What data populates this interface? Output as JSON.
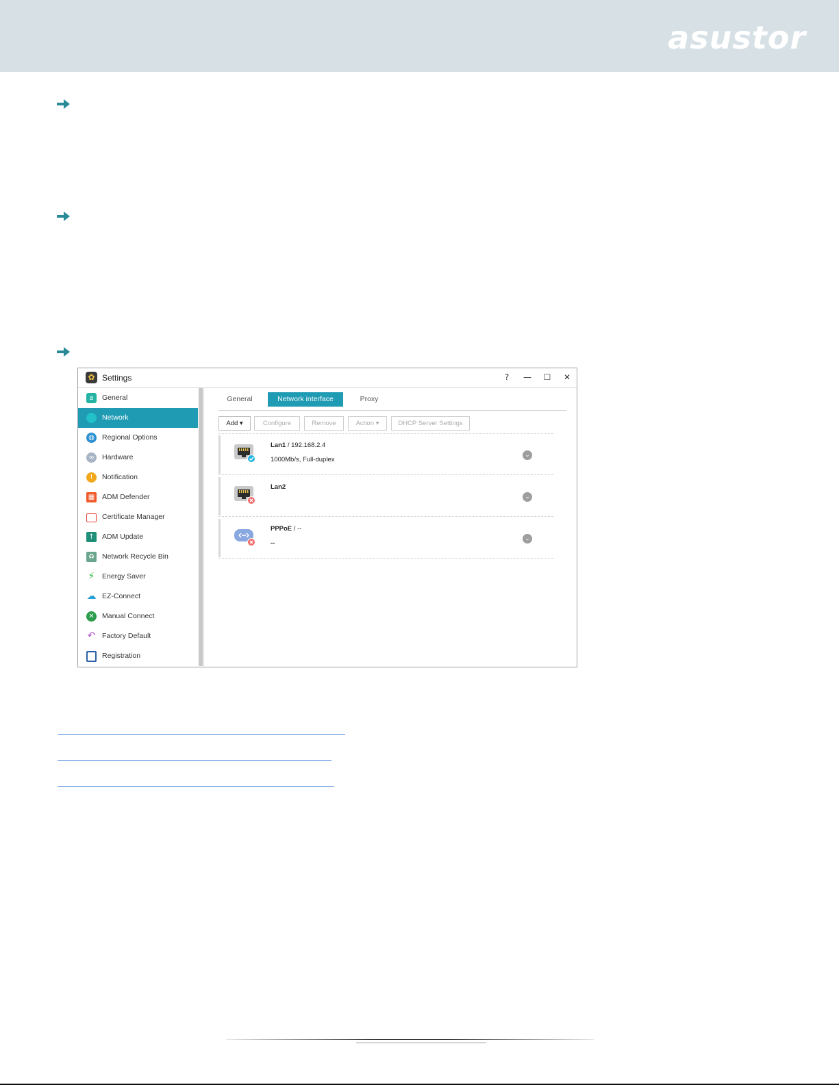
{
  "brand": {
    "logo_text": "asustor"
  },
  "window": {
    "title": "Settings",
    "controls": [
      "?",
      "—",
      "☐",
      "✕"
    ]
  },
  "sidebar": {
    "items": [
      {
        "label": "General",
        "icon": "general-icon",
        "color": "#22b3a3"
      },
      {
        "label": "Network",
        "icon": "globe-icon",
        "color": "#22c0c7",
        "active": true
      },
      {
        "label": "Regional Options",
        "icon": "regional-globe-icon",
        "color": "#2a8fd0"
      },
      {
        "label": "Hardware",
        "icon": "hardware-link-icon",
        "color": "#8a9bb0"
      },
      {
        "label": "Notification",
        "icon": "alert-icon",
        "color": "#f2a81d"
      },
      {
        "label": "ADM Defender",
        "icon": "firewall-icon",
        "color": "#f05a2a"
      },
      {
        "label": "Certificate Manager",
        "icon": "certificate-icon",
        "color": "#e8413a"
      },
      {
        "label": "ADM Update",
        "icon": "monitor-update-icon",
        "color": "#1f8f7a"
      },
      {
        "label": "Network Recycle Bin",
        "icon": "recycle-bin-icon",
        "color": "#6aa58e"
      },
      {
        "label": "Energy Saver",
        "icon": "energy-icon",
        "color": "#2cba3b"
      },
      {
        "label": "EZ-Connect",
        "icon": "cloud-upload-icon",
        "color": "#2aa0d6"
      },
      {
        "label": "Manual Connect",
        "icon": "manual-connect-icon",
        "color": "#2a9c4b"
      },
      {
        "label": "Factory Default",
        "icon": "undo-icon",
        "color": "#b04fc4"
      },
      {
        "label": "Registration",
        "icon": "clipboard-icon",
        "color": "#2a5fa8"
      }
    ]
  },
  "tabs": [
    {
      "label": "General"
    },
    {
      "label": "Network interface",
      "active": true
    },
    {
      "label": "Proxy"
    }
  ],
  "toolbar": {
    "add": "Add ▾",
    "configure": "Configure",
    "remove": "Remove",
    "action": "Action ▾",
    "dhcp": "DHCP Server Settings"
  },
  "interfaces": [
    {
      "name": "Lan1",
      "detail": " / 192.168.2.4",
      "sub": "1000Mb/s, Full-duplex",
      "icon": "ethernet-port-icon",
      "status": "connected"
    },
    {
      "name": "Lan2",
      "detail": "",
      "sub": "",
      "icon": "ethernet-port-icon",
      "status": "disconnected"
    },
    {
      "name": "PPPoE",
      "detail": " / --",
      "sub": "--",
      "icon": "pppoe-icon",
      "status": "disconnected"
    }
  ],
  "colors": {
    "accent": "#1f9bb3",
    "banner": "#d7e0e5",
    "arrow": "#2a8a98",
    "link": "#3b7fd6"
  }
}
